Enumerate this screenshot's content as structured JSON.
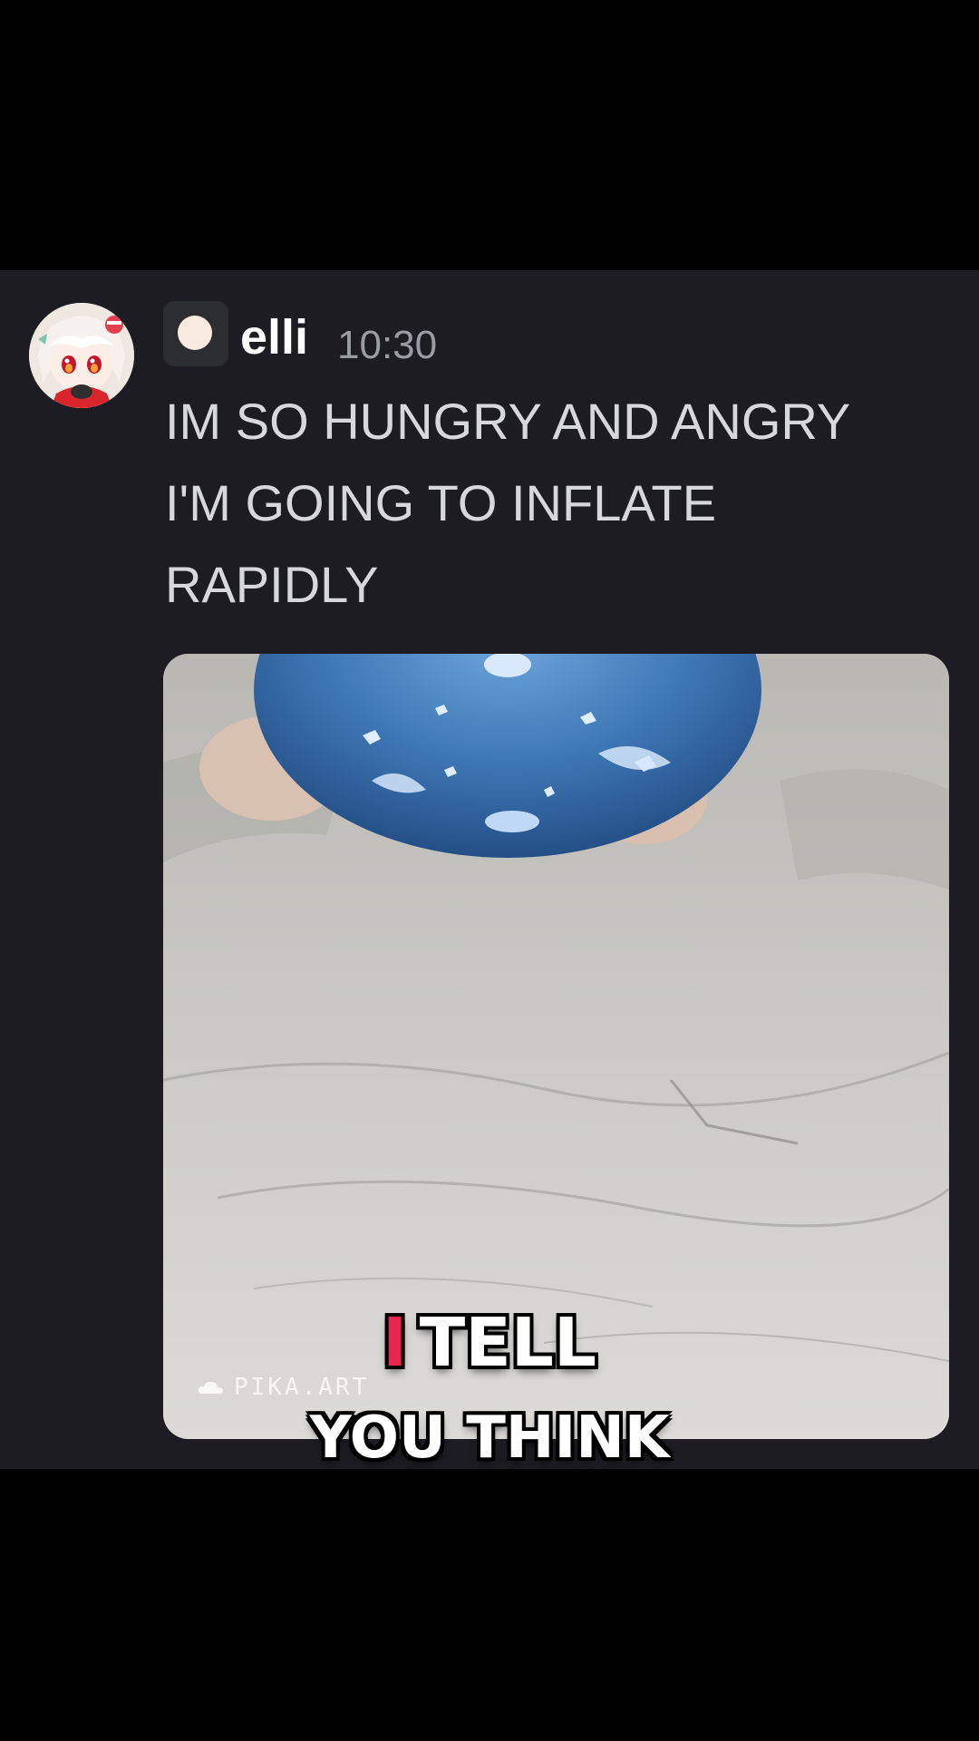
{
  "message": {
    "username": "elli",
    "timestamp": "10:30",
    "text": "IM SO HUNGRY AND ANGRY\nI'M GOING TO INFLATE\nRAPIDLY"
  },
  "media": {
    "watermark": "PIKA.ART"
  },
  "caption": {
    "highlight_word": "I",
    "line1_rest": "TELL",
    "line2": "YOU THINK"
  },
  "colors": {
    "chat_background": "#1c1c22",
    "outer_background": "#000000",
    "username": "#ffffff",
    "timestamp": "#9a9ca3",
    "message_text": "#d7d8dc",
    "caption_highlight": "#e8244f"
  },
  "icons": {
    "avatar": "anime-avatar-image",
    "badge": "role-dot-icon",
    "watermark": "cloud-icon"
  }
}
